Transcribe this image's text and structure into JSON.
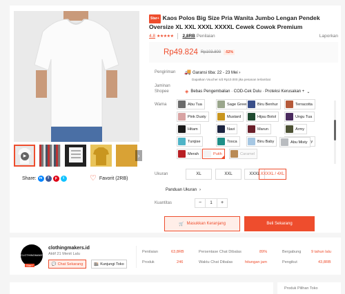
{
  "product": {
    "badge": "Star+",
    "title": "Kaos Polos Big Size Pria Wanita Jumbo Lengan Pendek Oversize XL XXL XXXL XXXXL Cewek Cowok Premium",
    "rating": "4.8",
    "stars": "★★★★★",
    "rating_count": "2,8RB",
    "rating_label": "Penilaian",
    "report": "Laporkan",
    "price": "Rp49.824",
    "old_price": "Rp103.800",
    "discount": "-52%"
  },
  "share": {
    "label": "Share:",
    "icons": [
      "messenger-icon",
      "facebook-icon",
      "pinterest-icon",
      "twitter-icon"
    ]
  },
  "favorite": {
    "label": "Favorit (2RB)"
  },
  "shipping": {
    "label": "Pengiriman",
    "guarantee": "Garansi tiba: 22 - 23 Mei",
    "sub": "Dapatkan Voucher s/d Rp10.000 jika pesanan terlambat"
  },
  "shopee_guarantee": {
    "label": "Jaminan Shopee",
    "text": "Bebas Pengembalian · COD-Cek Dulu · Proteksi Kerusakan +"
  },
  "color": {
    "label": "Warna",
    "selected": "Putih",
    "options": [
      {
        "name": "Abu Tua",
        "swatch": "#6b6b6b"
      },
      {
        "name": "Sage Green",
        "swatch": "#9aa68c"
      },
      {
        "name": "Biru Benhur",
        "swatch": "#3a4f8a"
      },
      {
        "name": "Terracotta",
        "swatch": "#b55a3a"
      },
      {
        "name": "Pink Dusty",
        "swatch": "#d8a3a3"
      },
      {
        "name": "Mustard",
        "swatch": "#c9961f"
      },
      {
        "name": "Hijau Botol",
        "swatch": "#1f4a30"
      },
      {
        "name": "Ungu Tua",
        "swatch": "#4a2a5e"
      },
      {
        "name": "Hitam",
        "swatch": "#1a1a1a"
      },
      {
        "name": "Navi",
        "swatch": "#1c2440"
      },
      {
        "name": "Marun",
        "swatch": "#6a1f2a"
      },
      {
        "name": "Army",
        "swatch": "#4d5234"
      },
      {
        "name": "Turqise",
        "swatch": "#4fb4c7"
      },
      {
        "name": "Tosca",
        "swatch": "#1f8f88"
      },
      {
        "name": "Biru Baby",
        "swatch": "#a6c7e3"
      },
      {
        "name": "Pink Baby",
        "swatch": "#f0c2cc"
      },
      {
        "name": "Abu Misty",
        "swatch": "#b9bcc0"
      },
      {
        "name": "Merah",
        "swatch": "#b81f24"
      },
      {
        "name": "Putih",
        "swatch": "#f3f3f3"
      },
      {
        "name": "Caramel",
        "swatch": "#b98a55"
      }
    ]
  },
  "size": {
    "label": "Ukuran",
    "options": [
      "XL",
      "XXL",
      "XXXL",
      "XXXXL / 4XL"
    ],
    "selected": "XXXXL / 4XL",
    "guide": "Panduan Ukuran"
  },
  "quantity": {
    "label": "Kuantitas",
    "value": "1",
    "minus": "−",
    "plus": "+"
  },
  "actions": {
    "add_to_cart": "Masukkan Keranjang",
    "buy_now": "Beli Sekarang"
  },
  "shop": {
    "name": "clothingmakers.id",
    "avatar_text": "CLOTHINGMAKERS",
    "active": "Aktif 21 Menit Lalu",
    "star_tag": "Star+",
    "chat": "Chat Sekarang",
    "visit": "Kunjungi Toko",
    "stats": [
      {
        "label": "Penilaian",
        "value": "63,8RB"
      },
      {
        "label": "Produk",
        "value": "246"
      },
      {
        "label": "Persentase Chat Dibalas",
        "value": "89%"
      },
      {
        "label": "Waktu Chat Dibalas",
        "value": "hitungan jam"
      },
      {
        "label": "Bergabung",
        "value": "9 tahun lalu"
      },
      {
        "label": "Pengikut",
        "value": "43,8RB"
      }
    ]
  },
  "sidebar": {
    "title": "Produk Pilihan Toko"
  },
  "colors": {
    "accent": "#ee4d2d",
    "teal": "#00bfa5"
  }
}
